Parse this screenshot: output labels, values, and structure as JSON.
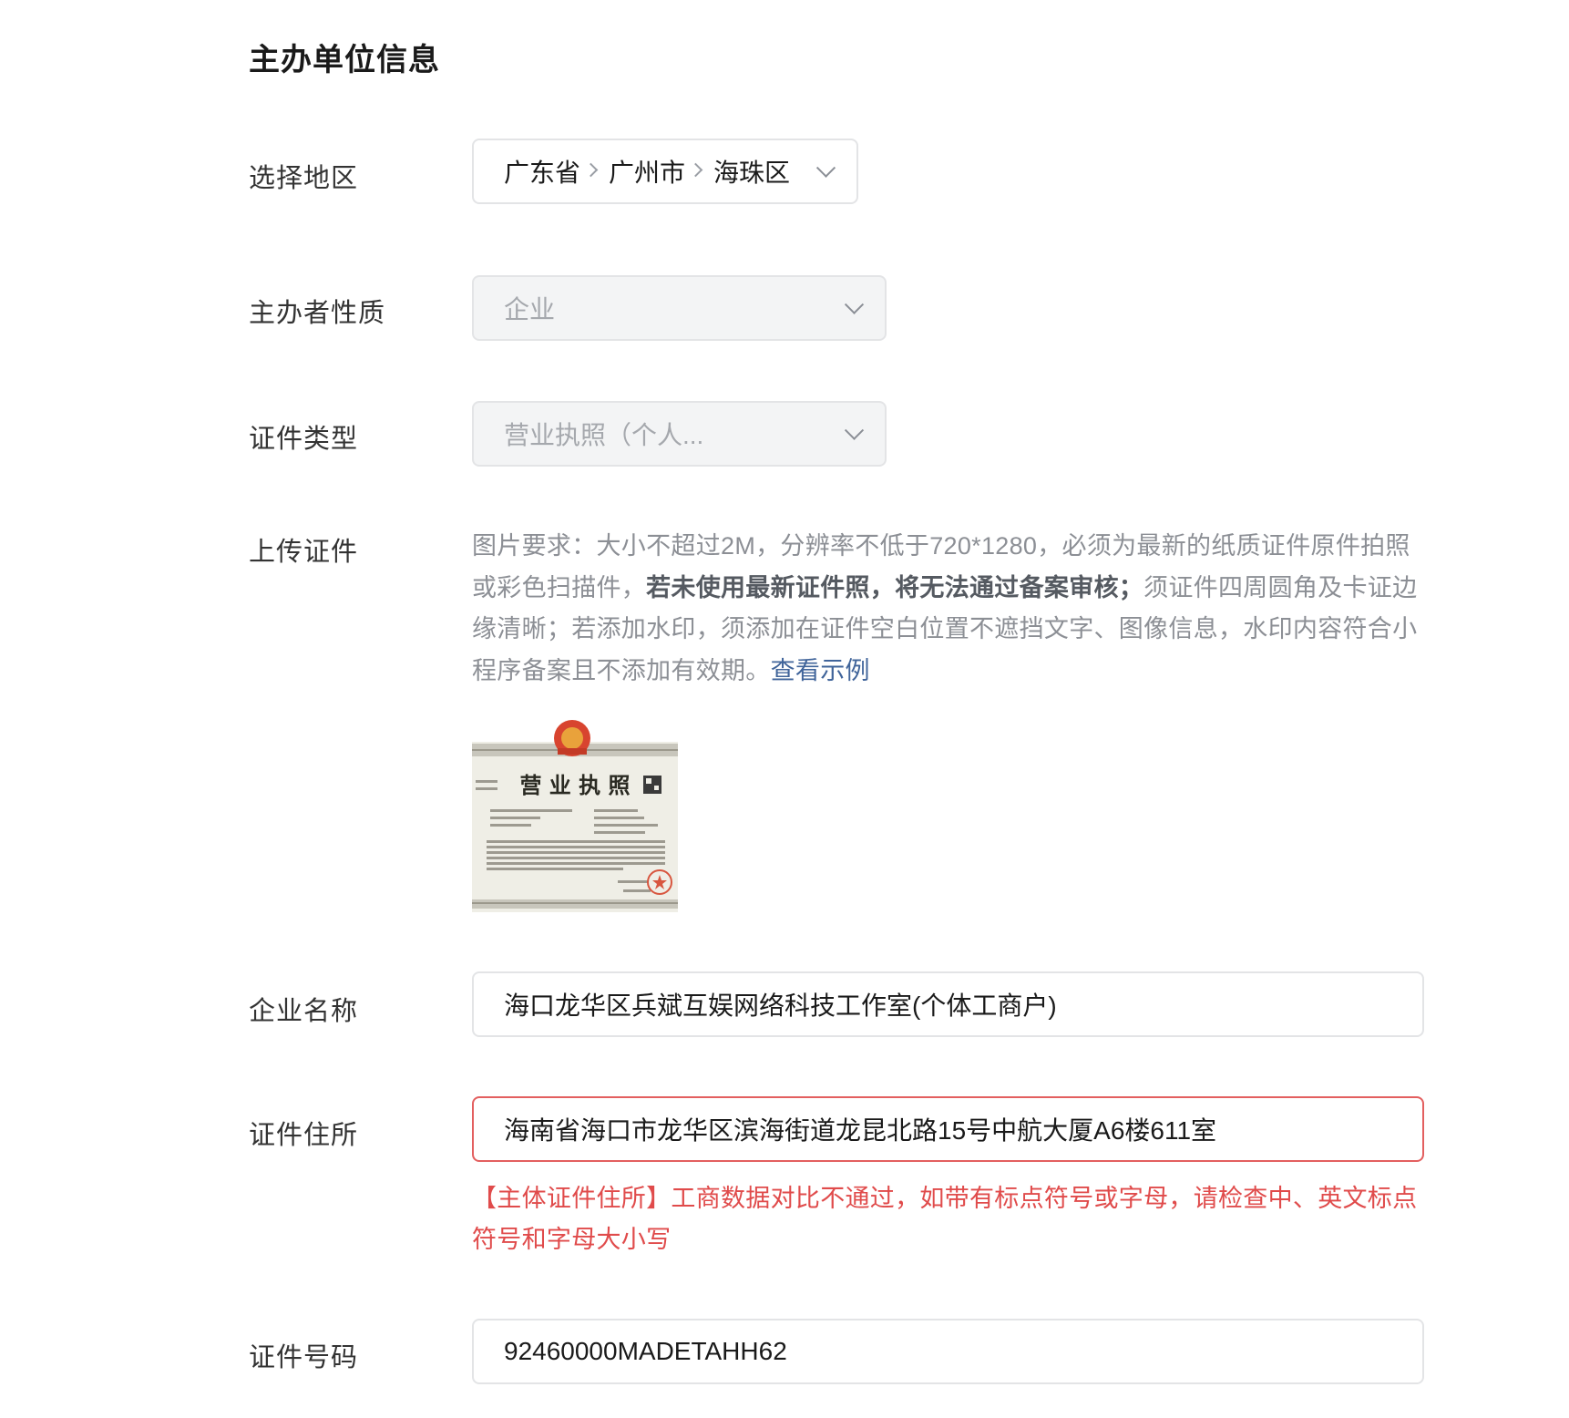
{
  "section_title": "主办单位信息",
  "region": {
    "label": "选择地区",
    "province": "广东省",
    "city": "广州市",
    "district": "海珠区"
  },
  "organizer_nature": {
    "label": "主办者性质",
    "value": "企业"
  },
  "cert_type": {
    "label": "证件类型",
    "value": "营业执照（个人..."
  },
  "upload": {
    "label": "上传证件",
    "help_part1": "图片要求：大小不超过2M，分辨率不低于720*1280，必须为最新的纸质证件原件拍照或彩色扫描件，",
    "help_bold": "若未使用最新证件照，将无法通过备案审核；",
    "help_part2": "须证件四周圆角及卡证边缘清晰；若添加水印，须添加在证件空白位置不遮挡文字、图像信息，水印内容符合小程序备案且不添加有效期。",
    "help_link": "查看示例",
    "license_title": "营 业 执 照"
  },
  "company_name": {
    "label": "企业名称",
    "value": "海口龙华区兵斌互娱网络科技工作室(个体工商户)"
  },
  "cert_address": {
    "label": "证件住所",
    "value": "海南省海口市龙华区滨海街道龙昆北路15号中航大厦A6楼611室",
    "error": "【主体证件住所】工商数据对比不通过，如带有标点符号或字母，请检查中、英文标点符号和字母大小写"
  },
  "cert_number": {
    "label": "证件号码",
    "value": "92460000MADETAHH62"
  }
}
